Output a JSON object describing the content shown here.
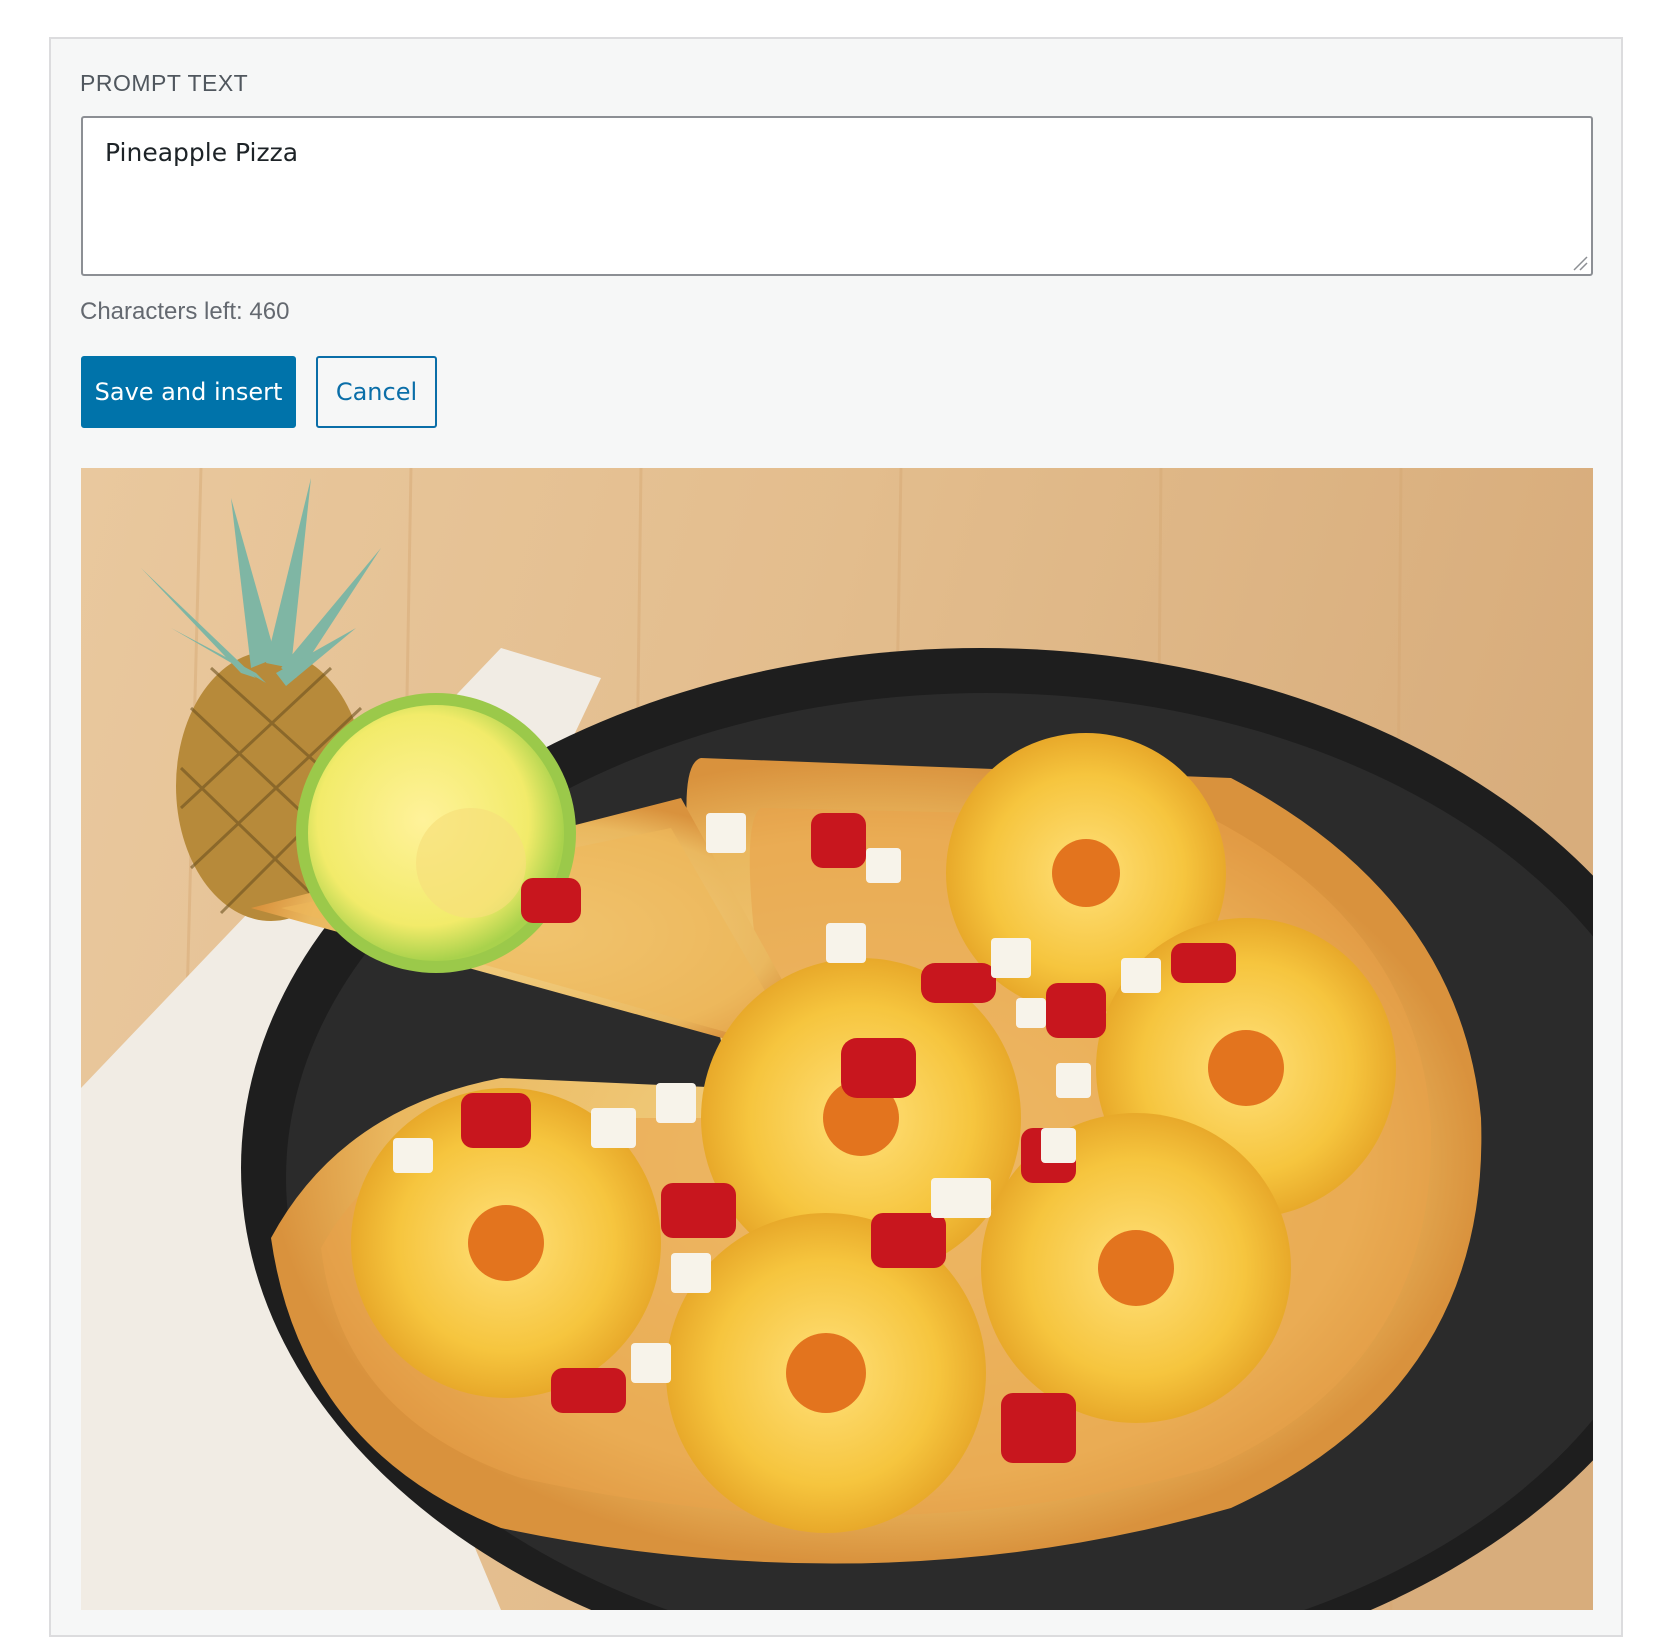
{
  "form": {
    "prompt_label": "PROMPT TEXT",
    "prompt_value": "Pineapple Pizza",
    "characters_left_text": "Characters left: 460"
  },
  "actions": {
    "save_label": "Save and insert",
    "cancel_label": "Cancel"
  },
  "colors": {
    "primary_button": "#0073aa",
    "secondary_button_border": "#0a6ea8",
    "panel_background": "#f6f7f7"
  }
}
